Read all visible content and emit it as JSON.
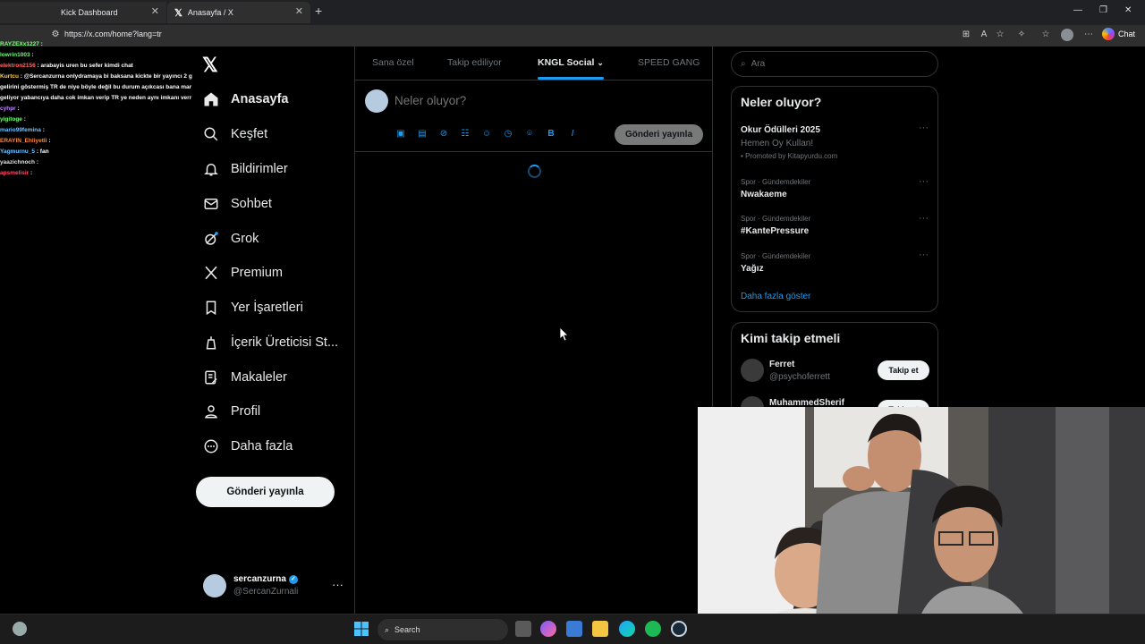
{
  "browser": {
    "tabs": [
      {
        "label": "Kick Dashboard"
      },
      {
        "label": "Anasayfa / X"
      }
    ],
    "url": "https://x.com/home?lang=tr",
    "chat_label": "Chat"
  },
  "stream_chat": [
    {
      "user": "RAYZEXx1227",
      "text": ":"
    },
    {
      "user": "lowrin1003",
      "text": ":"
    },
    {
      "user": "elektron2156",
      "text": ": arabayis uren bu sefer kimdi chat"
    },
    {
      "user": "Kurtcu",
      "text": ": @Sercanzurna onlydramaya bi baksana kickte bir yayıncı 2 g"
    },
    {
      "user": "",
      "text": "gelirini göstermiş TR de niye böyle değil bu durum açıkcası bana mar"
    },
    {
      "user": "",
      "text": "geliyor yabancıya daha cok imkan verip TR ye neden aynı imkanı verr"
    },
    {
      "user": "cyhpr",
      "text": ":"
    },
    {
      "user": "yigitoge",
      "text": ":"
    },
    {
      "user": "mario99femina",
      "text": ":"
    },
    {
      "user": "ERAYIN_Ehliyetli",
      "text": ":"
    },
    {
      "user": "Yagmurnu_5",
      "text": ": fan"
    },
    {
      "user": "yaazichnoch",
      "text": ":"
    },
    {
      "user": "apsmelisir",
      "text": ":"
    }
  ],
  "nav": {
    "items": [
      {
        "label": "Anasayfa"
      },
      {
        "label": "Keşfet"
      },
      {
        "label": "Bildirimler"
      },
      {
        "label": "Sohbet"
      },
      {
        "label": "Grok"
      },
      {
        "label": "Premium"
      },
      {
        "label": "Yer İşaretleri"
      },
      {
        "label": "İçerik Üreticisi St..."
      },
      {
        "label": "Makaleler"
      },
      {
        "label": "Profil"
      },
      {
        "label": "Daha fazla"
      }
    ],
    "post_button": "Gönderi yayınla"
  },
  "account": {
    "name": "sercanzurna",
    "handle": "@SercanZurnali"
  },
  "feed": {
    "tabs": [
      "Sana özel",
      "Takip ediliyor",
      "KNGL Social",
      "SPEED GANG"
    ],
    "active_tab": "KNGL Social",
    "compose_placeholder": "Neler oluyor?",
    "post_button": "Gönderi yayınla"
  },
  "sidebar": {
    "search_placeholder": "Ara",
    "trends_title": "Neler oluyor?",
    "promo": {
      "name": "Okur Ödülleri 2025",
      "sub": "Hemen Oy Kullan!",
      "meta": "Promoted by Kitapyurdu.com"
    },
    "trends": [
      {
        "meta": "Spor · Gündemdekiler",
        "name": "Nwakaeme"
      },
      {
        "meta": "Spor · Gündemdekiler",
        "name": "#KantePressure"
      },
      {
        "meta": "Spor · Gündemdekiler",
        "name": "Yağız"
      }
    ],
    "show_more": "Daha fazla göster",
    "who_title": "Kimi takip etmeli",
    "who": [
      {
        "name": "Ferret",
        "handle": "@psychoferrett",
        "button": "Takip et"
      },
      {
        "name": "MuhammedSherif",
        "handle": "",
        "button": "Takip et"
      }
    ]
  },
  "taskbar": {
    "search_label": "Search"
  },
  "colors": {
    "accent": "#1d9bf0",
    "background": "#000000",
    "border": "#2f3336"
  }
}
